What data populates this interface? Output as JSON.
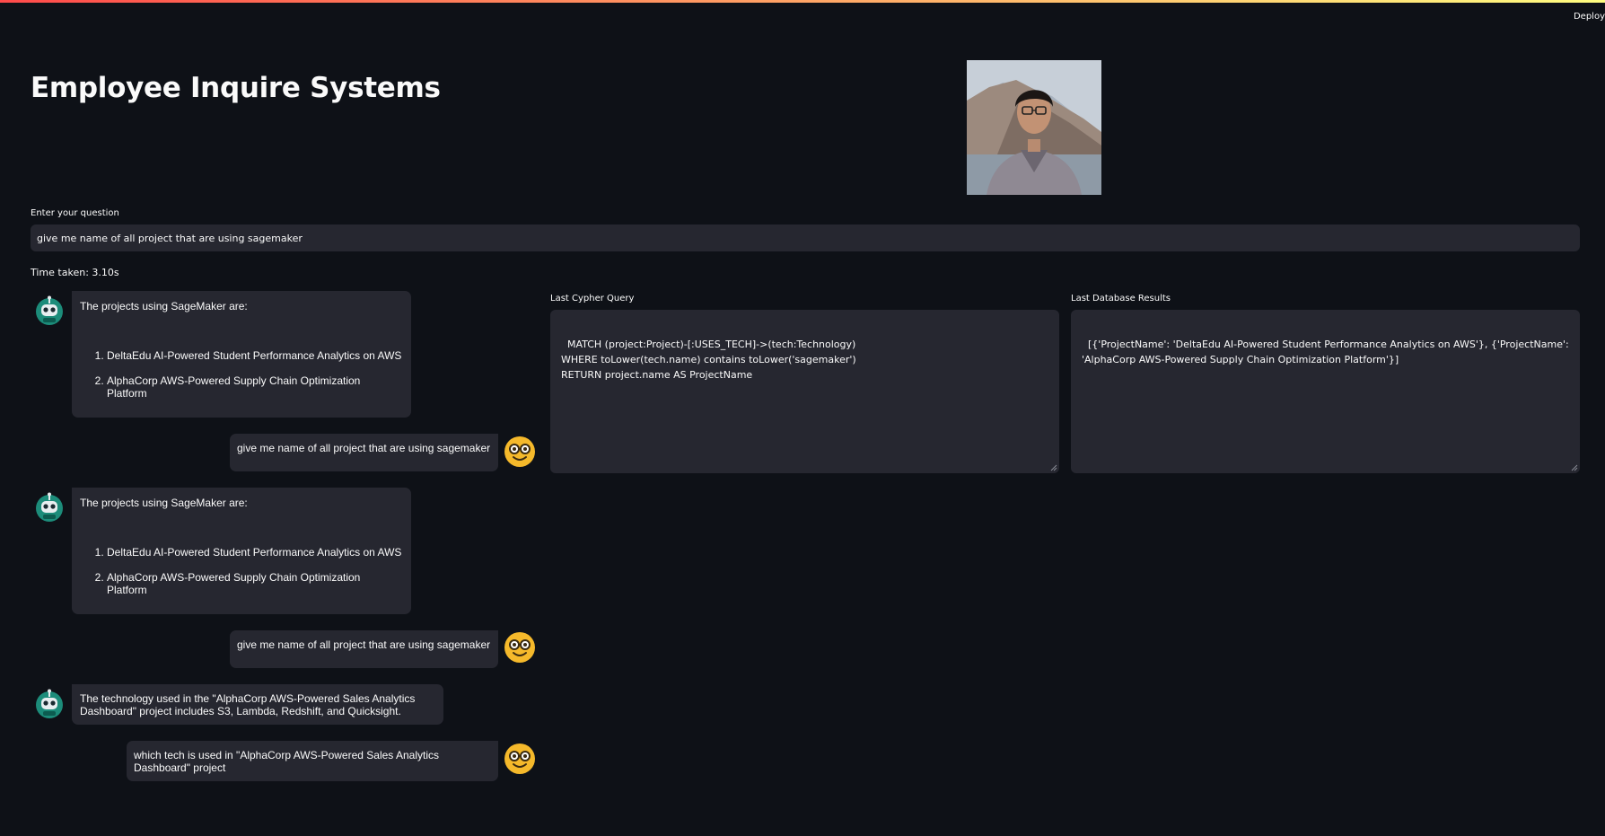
{
  "header": {
    "deploy_label": "Deploy"
  },
  "page": {
    "title": "Employee Inquire Systems"
  },
  "question": {
    "label": "Enter your question",
    "value": "give me name of all project that are using sagemaker"
  },
  "status": {
    "time_taken": "Time taken: 3.10s"
  },
  "chat": {
    "messages": [
      {
        "role": "assistant",
        "intro": "The projects using SageMaker are:",
        "items": [
          "DeltaEdu AI-Powered Student Performance Analytics on AWS",
          "AlphaCorp AWS-Powered Supply Chain Optimization Platform"
        ]
      },
      {
        "role": "user",
        "text": "give me name of all project that are using sagemaker"
      },
      {
        "role": "assistant",
        "intro": "The projects using SageMaker are:",
        "items": [
          "DeltaEdu AI-Powered Student Performance Analytics on AWS",
          "AlphaCorp AWS-Powered Supply Chain Optimization Platform"
        ]
      },
      {
        "role": "user",
        "text": "give me name of all project that are using sagemaker"
      },
      {
        "role": "assistant",
        "text": "The technology used in the \"AlphaCorp AWS-Powered Sales Analytics Dashboard\" project includes S3, Lambda, Redshift, and Quicksight."
      },
      {
        "role": "user",
        "text": "which tech is used in \"AlphaCorp AWS-Powered Sales Analytics Dashboard\" project"
      }
    ]
  },
  "cypher_panel": {
    "label": "Last Cypher Query",
    "value": "MATCH (project:Project)-[:USES_TECH]->(tech:Technology)\nWHERE toLower(tech.name) contains toLower('sagemaker')\nRETURN project.name AS ProjectName"
  },
  "results_panel": {
    "label": "Last Database Results",
    "value": "[{'ProjectName': 'DeltaEdu AI-Powered Student Performance Analytics on AWS'}, {'ProjectName': 'AlphaCorp AWS-Powered Supply Chain Optimization Platform'}]"
  },
  "icons": {
    "assistant_avatar": "robot-icon",
    "user_avatar": "nerd-face-icon",
    "profile_photo": "profile-photo"
  },
  "colors": {
    "background": "#0e1117",
    "surface": "#262730",
    "text": "#fafafa",
    "accent_start": "#ff4b4b",
    "accent_end": "#fffd80",
    "user_avatar": "#f5b92b",
    "assistant_avatar": "#1c8c7a"
  }
}
